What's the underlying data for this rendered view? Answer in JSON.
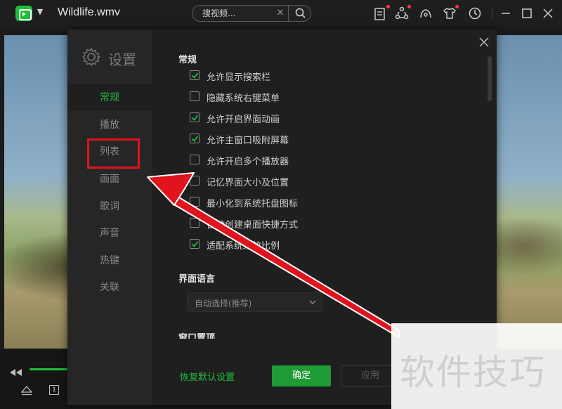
{
  "window": {
    "title": "Wildlife.wmv",
    "search_placeholder": "搜视频...",
    "search_clear": "✕"
  },
  "controls": {
    "playlist_mode": "1"
  },
  "settings": {
    "title": "设置",
    "nav": [
      {
        "label": "常规",
        "active": true
      },
      {
        "label": "播放",
        "active": false
      },
      {
        "label": "列表",
        "active": false
      },
      {
        "label": "画面",
        "active": false
      },
      {
        "label": "歌词",
        "active": false
      },
      {
        "label": "声音",
        "active": false
      },
      {
        "label": "热键",
        "active": false
      },
      {
        "label": "关联",
        "active": false
      }
    ],
    "general": {
      "heading": "常规",
      "options": [
        {
          "label": "允许显示搜索栏",
          "checked": true
        },
        {
          "label": "隐藏系统右键菜单",
          "checked": false
        },
        {
          "label": "允许开启界面动画",
          "checked": true
        },
        {
          "label": "允许主窗口吸附屏幕",
          "checked": true
        },
        {
          "label": "允许开启多个播放器",
          "checked": false
        },
        {
          "label": "记忆界面大小及位置",
          "checked": false
        },
        {
          "label": "最小化到系统托盘图标",
          "checked": false
        },
        {
          "label": "自动创建桌面快捷方式",
          "checked": false
        },
        {
          "label": "适配系统缩放比例",
          "checked": true
        }
      ]
    },
    "language": {
      "heading": "界面语言",
      "selected": "自动选择(推荐)"
    },
    "next_section_heading": "窗口置顶",
    "footer": {
      "restore_defaults": "恢复默认设置",
      "ok": "确定",
      "apply": "应用"
    }
  },
  "annotation": {
    "color": "#e0141e"
  },
  "watermark": {
    "text": "软件技巧"
  },
  "colors": {
    "accent": "#1fbf3c",
    "background": "#1f1f1f",
    "sidebar": "#262626"
  }
}
